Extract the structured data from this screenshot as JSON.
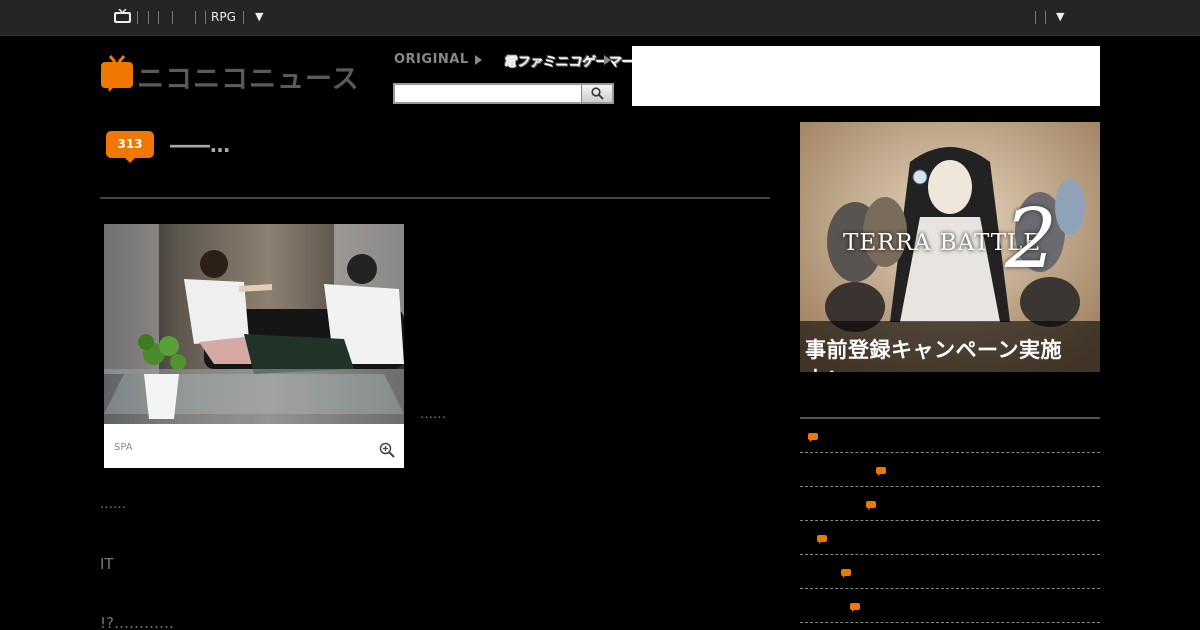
{
  "topbar": {
    "icon": "niconico-tv-icon",
    "genre_label": "RPG",
    "dropdown_glyph": "▼",
    "right_dropdown_glyph": "▼"
  },
  "header": {
    "logo_text": "ニコニコニュース",
    "original_label": "ORIGINAL",
    "partner_label": "電ファミニコゲーマー",
    "search": {
      "placeholder": "",
      "button_icon": "search-icon"
    }
  },
  "article": {
    "comment_count": "313",
    "title": "――…",
    "photo_caption": "SPA",
    "zoom_icon": "zoom-in-icon",
    "paragraphs": [
      "……",
      "……",
      "IT",
      "!?…………"
    ]
  },
  "sidebar": {
    "banner": {
      "title": "TERRA BATTLE",
      "number": "2",
      "cta": "事前登録キャンペーン実施中！"
    },
    "items_count_icon": "comment-bubble-icon",
    "items": [
      {
        "icon": "comment-bubble-icon"
      },
      {
        "icon": "comment-bubble-icon"
      },
      {
        "icon": "comment-bubble-icon"
      },
      {
        "icon": "comment-bubble-icon"
      },
      {
        "icon": "comment-bubble-icon"
      },
      {
        "icon": "comment-bubble-icon"
      }
    ]
  },
  "colors": {
    "accent": "#f07800",
    "topbar_bg": "#252525",
    "page_bg": "#000000"
  }
}
